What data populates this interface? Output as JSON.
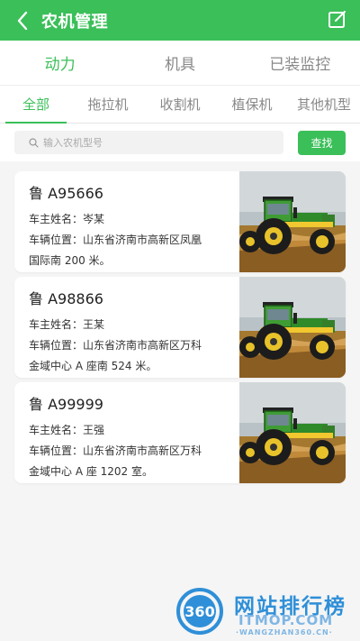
{
  "header": {
    "title": "农机管理"
  },
  "main_tabs": [
    {
      "label": "动力",
      "active": true
    },
    {
      "label": "机具",
      "active": false
    },
    {
      "label": "已装监控",
      "active": false
    }
  ],
  "sub_tabs": [
    {
      "label": "全部",
      "active": true
    },
    {
      "label": "拖拉机",
      "active": false
    },
    {
      "label": "收割机",
      "active": false
    },
    {
      "label": "植保机",
      "active": false
    },
    {
      "label": "其他机型",
      "active": false
    }
  ],
  "search": {
    "placeholder": "输入农机型号",
    "button_label": "查找"
  },
  "vehicles": [
    {
      "plate": "鲁 A95666",
      "owner": "车主姓名：岑某",
      "location_line1": "车辆位置：山东省济南市高新区凤凰",
      "location_line2": "国际南 200 米。"
    },
    {
      "plate": "鲁 A98866",
      "owner": "车主姓名：王某",
      "location_line1": "车辆位置：山东省济南市高新区万科",
      "location_line2": "金域中心 A 座南 524 米。"
    },
    {
      "plate": "鲁 A99999",
      "owner": "车主姓名：王强",
      "location_line1": "车辆位置：山东省济南市高新区万科",
      "location_line2": "金域中心 A 座 1202 室。"
    }
  ],
  "watermark": {
    "logo_text": "360",
    "title": "网站排行榜",
    "site": "ITMOP.COM",
    "sub": "·WANGZHAN360.CN·"
  },
  "colors": {
    "accent": "#3bbf59",
    "background": "#f5f5f5"
  }
}
